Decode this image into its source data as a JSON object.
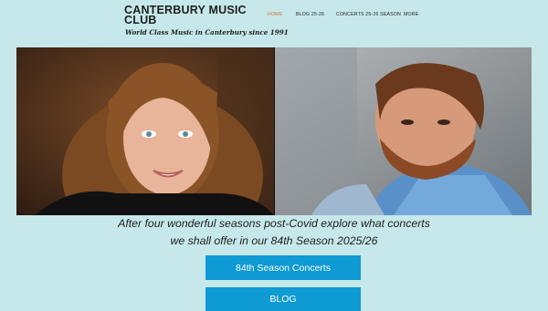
{
  "site": {
    "title": "CANTERBURY MUSIC CLUB",
    "tagline": "World Class Music in Canterbury since 1991"
  },
  "nav": {
    "items": [
      {
        "label": "HOME",
        "active": true
      },
      {
        "label": "BLOG 25-26",
        "active": false
      },
      {
        "label": "CONCERTS 25-26 SEASON",
        "active": false
      },
      {
        "label": "MORE",
        "active": false
      }
    ]
  },
  "intro": {
    "line1": "After four wonderful seasons post-Covid explore what concerts",
    "line2": "we shall offer in our 84th Season 2025/26"
  },
  "buttons": {
    "concerts_label": "84th Season Concerts",
    "blog_label": "BLOG"
  },
  "colors": {
    "background": "#c6e8eb",
    "button": "#0e9ad3",
    "nav_active": "#d9743a"
  }
}
